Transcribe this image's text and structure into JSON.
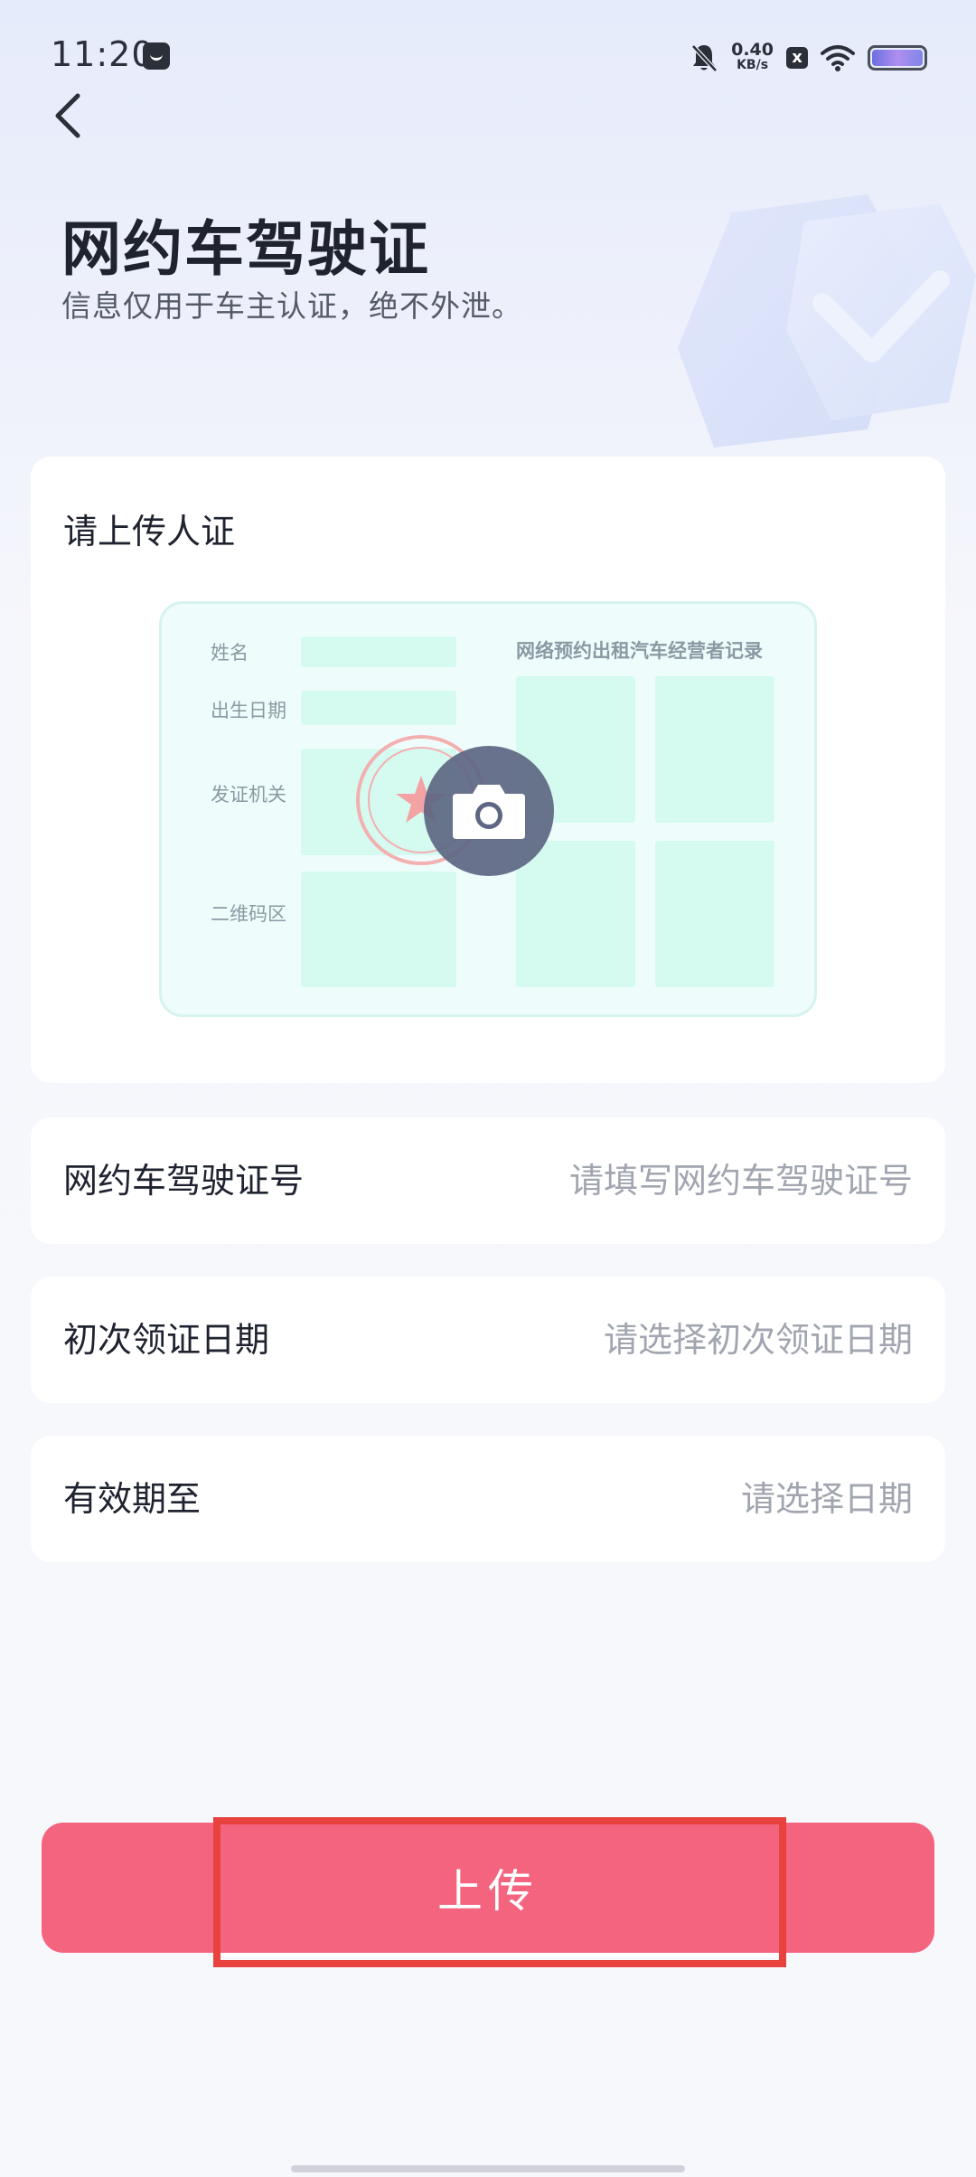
{
  "status_bar": {
    "time": "11:20",
    "network_speed_value": "0.40",
    "network_speed_unit": "KB/s",
    "sim_badge": "x",
    "icons": [
      "message-icon",
      "mute-bell-icon",
      "sim-off-icon",
      "wifi-icon",
      "battery-icon"
    ]
  },
  "header": {
    "back_icon": "chevron-left-icon",
    "title": "网约车驾驶证",
    "subtitle": "信息仅用于车主认证，绝不外泄。"
  },
  "upload_card": {
    "title": "请上传人证",
    "license_sample": {
      "labels": {
        "name": "姓名",
        "birth_date": "出生日期",
        "issuing_authority": "发证机关",
        "qr_area": "二维码区"
      },
      "record_title": "网络预约出租汽车经营者记录"
    },
    "camera_icon": "camera-icon"
  },
  "form": {
    "license_number": {
      "label": "网约车驾驶证号",
      "placeholder": "请填写网约车驾驶证号"
    },
    "first_issue_date": {
      "label": "初次领证日期",
      "placeholder": "请选择初次领证日期"
    },
    "valid_until": {
      "label": "有效期至",
      "placeholder": "请选择日期"
    }
  },
  "actions": {
    "upload_label": "上传"
  },
  "colors": {
    "primary_button": "#f4647f",
    "highlight_border": "#e8423f",
    "sample_background": "#eefdfb",
    "placeholder_text": "#a1a5b0"
  }
}
